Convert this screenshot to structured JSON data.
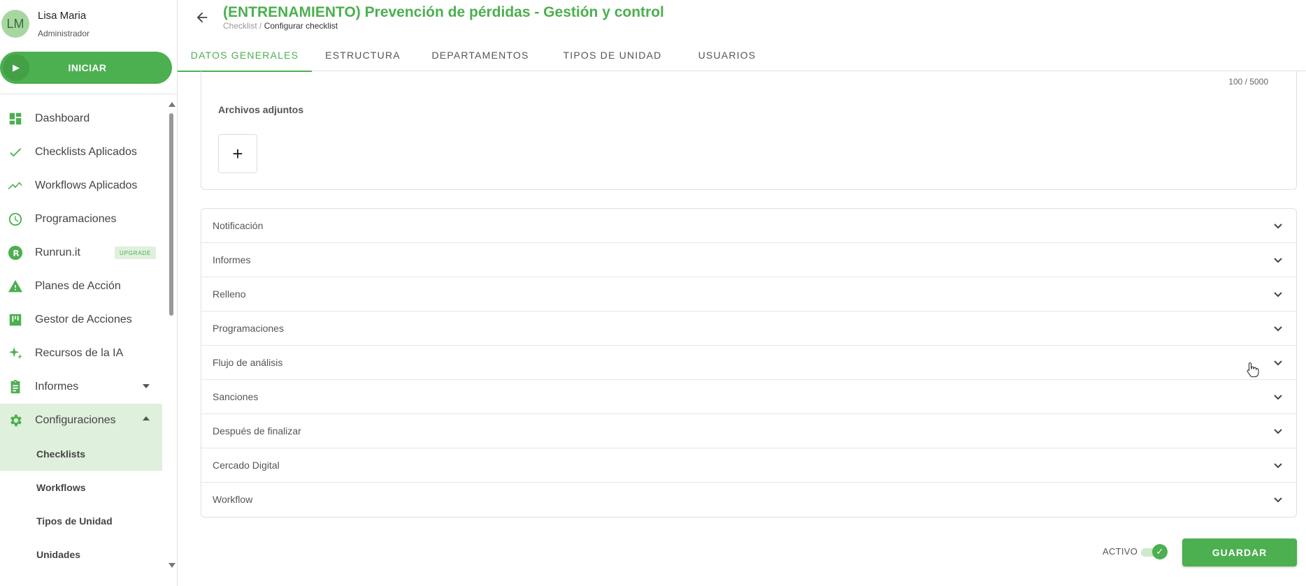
{
  "user": {
    "initials": "LM",
    "name": "Lisa Maria",
    "role": "Administrador"
  },
  "start_button": {
    "label": "INICIAR"
  },
  "nav": {
    "items": [
      {
        "label": "Dashboard",
        "icon": "dashboard-icon"
      },
      {
        "label": "Checklists Aplicados",
        "icon": "check-icon"
      },
      {
        "label": "Workflows Aplicados",
        "icon": "trending-icon"
      },
      {
        "label": "Programaciones",
        "icon": "clock-icon"
      },
      {
        "label": "Runrun.it",
        "icon": "runrun-logo-icon",
        "badge": "UPGRADE"
      },
      {
        "label": "Planes de Acción",
        "icon": "warning-icon"
      },
      {
        "label": "Gestor de Acciones",
        "icon": "kanban-icon"
      },
      {
        "label": "Recursos de la IA",
        "icon": "sparkle-icon"
      },
      {
        "label": "Informes",
        "icon": "clipboard-icon"
      },
      {
        "label": "Configuraciones",
        "icon": "gear-icon"
      }
    ],
    "sub_items": [
      "Checklists",
      "Workflows",
      "Tipos de Unidad",
      "Unidades"
    ]
  },
  "header": {
    "title": "(ENTRENAMIENTO) Prevención de pérdidas - Gestión y control",
    "breadcrumb_parent": "Checklist",
    "breadcrumb_sep": " / ",
    "breadcrumb_current": "Configurar checklist"
  },
  "tabs": [
    "DATOS GENERALES",
    "ESTRUCTURA",
    "DEPARTAMENTOS",
    "TIPOS DE UNIDAD",
    "USUARIOS"
  ],
  "general": {
    "char_counter": "100 / 5000",
    "attachments_label": "Archivos adjuntos",
    "add_symbol": "+"
  },
  "sections": [
    "Notificación",
    "Informes",
    "Relleno",
    "Programaciones",
    "Flujo de análisis",
    "Sanciones",
    "Después de finalizar",
    "Cercado Digital",
    "Workflow"
  ],
  "footer": {
    "active_label": "ACTIVO",
    "save_label": "GUARDAR"
  },
  "colors": {
    "accent": "#4caf50",
    "accent_light": "#dff0dc"
  }
}
